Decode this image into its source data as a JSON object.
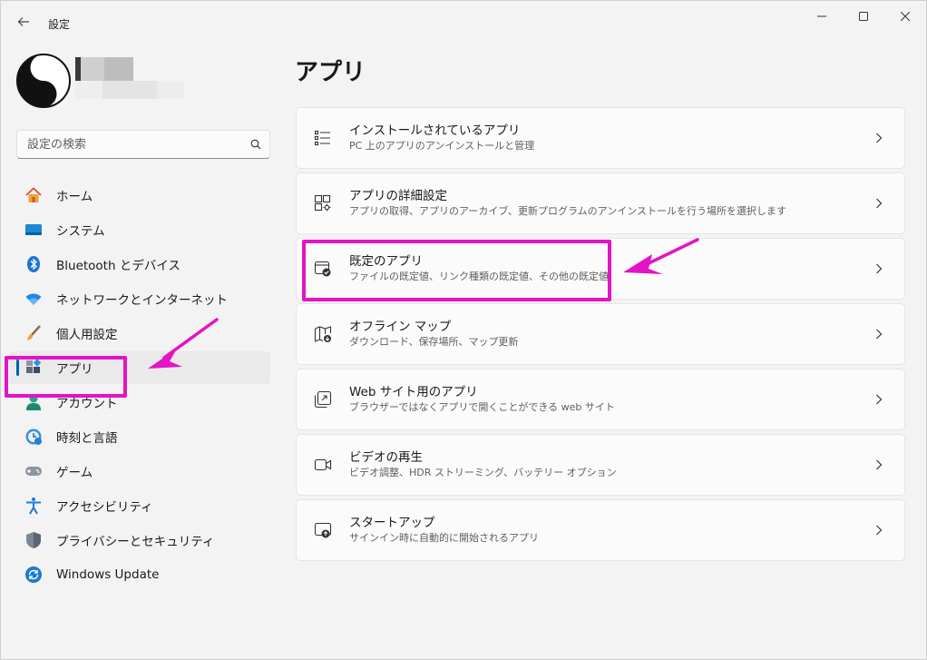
{
  "window": {
    "title": "設定"
  },
  "user": {
    "name": "",
    "email": ""
  },
  "search": {
    "placeholder": "設定の検索"
  },
  "sidebar": {
    "items": [
      {
        "label": "ホーム",
        "icon": "home-icon"
      },
      {
        "label": "システム",
        "icon": "system-icon"
      },
      {
        "label": "Bluetooth とデバイス",
        "icon": "bluetooth-icon"
      },
      {
        "label": "ネットワークとインターネット",
        "icon": "wifi-icon"
      },
      {
        "label": "個人用設定",
        "icon": "brush-icon"
      },
      {
        "label": "アプリ",
        "icon": "apps-icon",
        "active": true
      },
      {
        "label": "アカウント",
        "icon": "account-icon"
      },
      {
        "label": "時刻と言語",
        "icon": "time-language-icon"
      },
      {
        "label": "ゲーム",
        "icon": "gamepad-icon"
      },
      {
        "label": "アクセシビリティ",
        "icon": "accessibility-icon"
      },
      {
        "label": "プライバシーとセキュリティ",
        "icon": "shield-icon"
      },
      {
        "label": "Windows Update",
        "icon": "update-icon"
      }
    ]
  },
  "main": {
    "title": "アプリ",
    "cards": [
      {
        "title": "インストールされているアプリ",
        "desc": "PC 上のアプリのアンインストールと管理",
        "icon": "list-icon"
      },
      {
        "title": "アプリの詳細設定",
        "desc": "アプリの取得、アプリのアーカイブ、更新プログラムのアンインストールを行う場所を選択します",
        "icon": "app-settings-icon"
      },
      {
        "title": "既定のアプリ",
        "desc": "ファイルの既定値、リンク種類の既定値、その他の既定値",
        "icon": "default-apps-icon"
      },
      {
        "title": "オフライン マップ",
        "desc": "ダウンロード、保存場所、マップ更新",
        "icon": "map-download-icon"
      },
      {
        "title": "Web サイト用のアプリ",
        "desc": "ブラウザーではなくアプリで開くことができる web サイト",
        "icon": "open-link-icon"
      },
      {
        "title": "ビデオの再生",
        "desc": "ビデオ調整、HDR ストリーミング、バッテリー オプション",
        "icon": "video-icon"
      },
      {
        "title": "スタートアップ",
        "desc": "サインイン時に自動的に開始されるアプリ",
        "icon": "startup-icon"
      }
    ]
  },
  "colors": {
    "accent": "#005fb8",
    "highlight": "#e313c6",
    "background": "#f3f3f3",
    "card": "#fbfbfb"
  }
}
